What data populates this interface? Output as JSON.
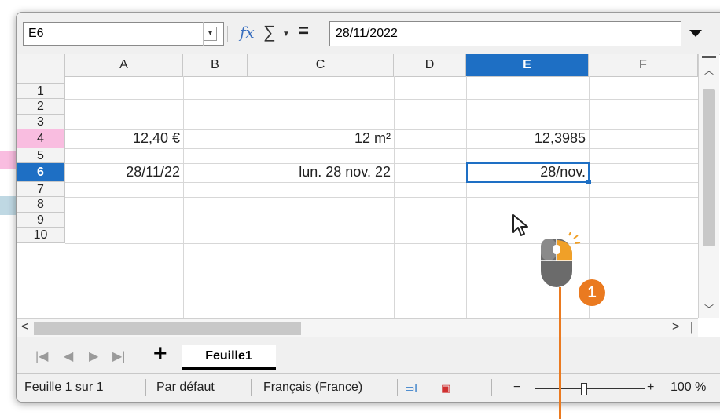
{
  "formula_bar": {
    "name_box": "E6",
    "fx_label": "fx",
    "sigma": "∑",
    "equals": "=",
    "content": "28/11/2022"
  },
  "columns": [
    "A",
    "B",
    "C",
    "D",
    "E",
    "F"
  ],
  "rows": [
    "1",
    "2",
    "3",
    "4",
    "5",
    "6",
    "7",
    "8",
    "9",
    "10"
  ],
  "cells": {
    "A4": "12,40 €",
    "C4": "12 m²",
    "E4": "12,3985",
    "A6": "28/11/22",
    "C6": "lun. 28 nov. 22",
    "E6": "28/nov."
  },
  "sheet_tabs": [
    "Feuille1"
  ],
  "status_bar": {
    "sheet": "Feuille 1 sur 1",
    "style": "Par défaut",
    "language": "Français (France)",
    "zoom": "100 %"
  },
  "zoom_percent": 100,
  "callout": {
    "number": "1",
    "color": "#ea7a20"
  },
  "colors": {
    "selection": "#1e6fc4",
    "row4_band": "#f9bde0",
    "row6_band": "#bfd8e3"
  },
  "icons": [
    "fx-icon",
    "sigma-icon",
    "equals-icon",
    "expand-icon",
    "scroll-up-icon",
    "scroll-down-icon",
    "scroll-left-icon",
    "scroll-right-icon",
    "first-sheet-icon",
    "prev-sheet-icon",
    "next-sheet-icon",
    "last-sheet-icon",
    "add-sheet-icon",
    "selection-mode-icon",
    "save-status-icon",
    "zoom-out-icon",
    "zoom-in-icon",
    "mouse-pointer-icon",
    "mouse-icon"
  ]
}
